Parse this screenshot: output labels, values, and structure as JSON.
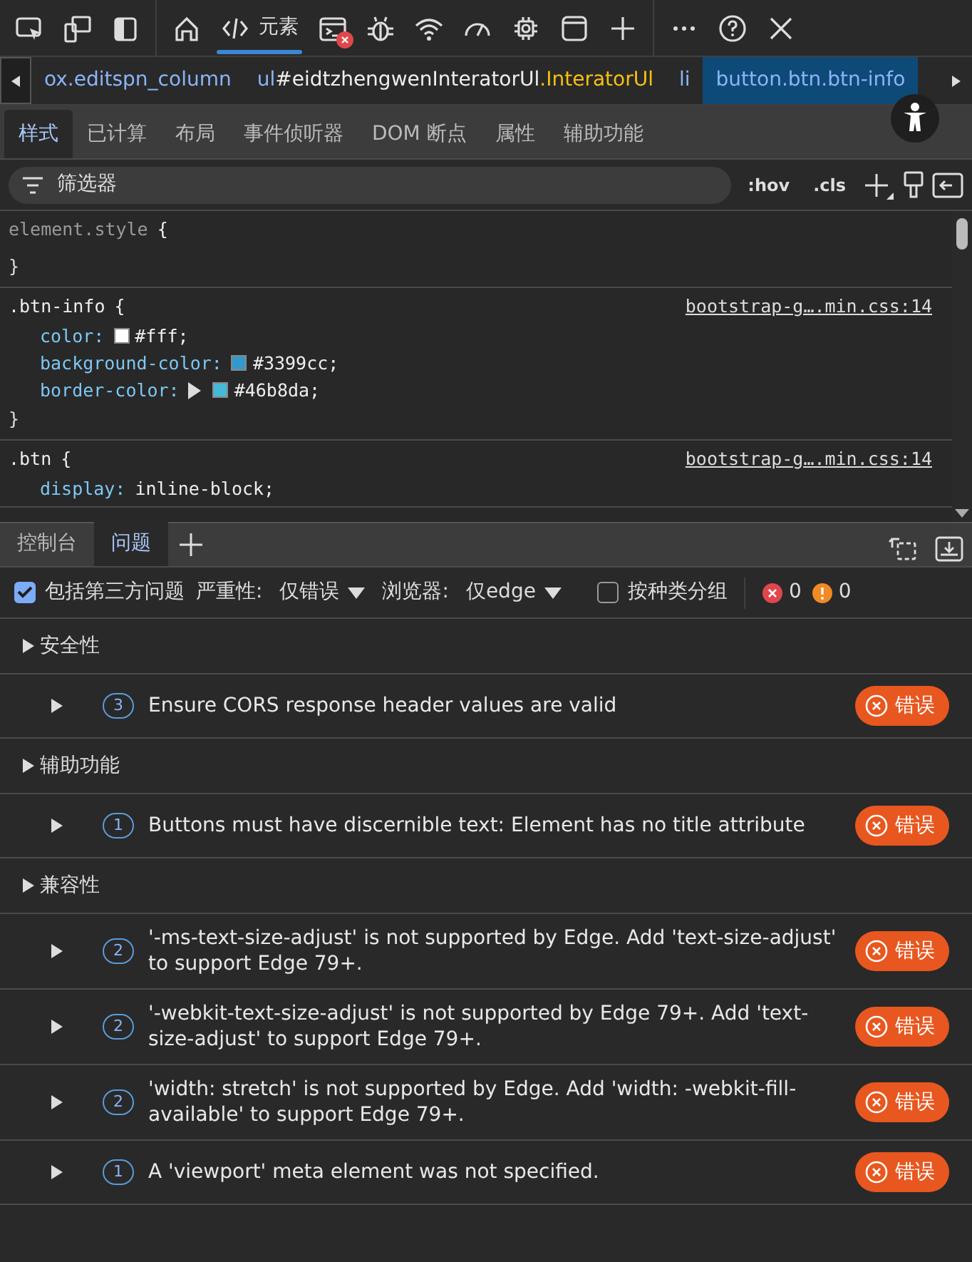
{
  "toolbar": {
    "tools": [
      {
        "kind": "inspect",
        "selected": false
      },
      {
        "kind": "device",
        "selected": false
      },
      {
        "kind": "dock",
        "selected": false
      },
      {
        "kind": "home",
        "selected": false
      },
      {
        "kind": "elements",
        "label": "元素",
        "selected": true
      },
      {
        "kind": "console",
        "selected": false,
        "error": true
      },
      {
        "kind": "bug",
        "selected": false
      },
      {
        "kind": "wifi",
        "selected": false
      },
      {
        "kind": "gauge",
        "selected": false
      },
      {
        "kind": "chip",
        "selected": false
      },
      {
        "kind": "window",
        "selected": false
      },
      {
        "kind": "plus",
        "selected": false
      }
    ],
    "actions": [
      {
        "kind": "more"
      },
      {
        "kind": "help"
      },
      {
        "kind": "close"
      }
    ]
  },
  "breadcrumbs": [
    {
      "parts": [
        {
          "text": "ox.editspn_column",
          "kind": "tag"
        }
      ],
      "selected": false
    },
    {
      "parts": [
        {
          "text": "ul",
          "kind": "tag"
        },
        {
          "text": "#eidtzhengwenInteratorUl",
          "kind": "id"
        },
        {
          "text": ".InteratorUl",
          "kind": "class"
        }
      ],
      "selected": false
    },
    {
      "parts": [
        {
          "text": "li",
          "kind": "tag"
        }
      ],
      "selected": false
    },
    {
      "parts": [
        {
          "text": "button.btn.btn-info",
          "kind": "tag"
        }
      ],
      "selected": true
    }
  ],
  "style_tabs": [
    {
      "label": "样式",
      "selected": true
    },
    {
      "label": "已计算",
      "selected": false
    },
    {
      "label": "布局",
      "selected": false
    },
    {
      "label": "事件侦听器",
      "selected": false
    },
    {
      "label": "DOM 断点",
      "selected": false
    },
    {
      "label": "属性",
      "selected": false
    },
    {
      "label": "辅助功能",
      "selected": false
    }
  ],
  "filter": {
    "placeholder": "筛选器",
    "buttons": [
      ":hov",
      ".cls"
    ]
  },
  "rules": [
    {
      "kind": "inline",
      "selector": "element.style",
      "open": "{",
      "close": "}"
    },
    {
      "kind": "rule",
      "selector": ".btn-info",
      "open": "{",
      "source": "bootstrap-g….min.css:14",
      "declarations": [
        {
          "property": "color:",
          "value": "#fff;",
          "color": "#ffffff",
          "expandable": false
        },
        {
          "property": "background-color:",
          "value": "#3399cc;",
          "color": "#3399cc",
          "expandable": false
        },
        {
          "property": "border-color:",
          "value": "#46b8da;",
          "color": "#46b8da",
          "expandable": true
        }
      ],
      "close": "}"
    },
    {
      "kind": "rule",
      "selector": ".btn",
      "open": "{",
      "source": "bootstrap-g….min.css:14",
      "declarations": [
        {
          "property": "display:",
          "value": "inline-block;",
          "expandable": false
        }
      ]
    }
  ],
  "drawer_tabs": [
    {
      "label": "控制台",
      "selected": false
    },
    {
      "label": "问题",
      "selected": true
    }
  ],
  "issues_toolbar": {
    "third_party": {
      "label": "包括第三方问题",
      "checked": true
    },
    "severity": {
      "label": "严重性:",
      "value": "仅错误"
    },
    "browser": {
      "label": "浏览器:",
      "value": "仅edge"
    },
    "group_by_kind": {
      "label": "按种类分组",
      "checked": false
    },
    "errors": "0",
    "warnings": "0"
  },
  "groups": [
    {
      "title": "安全性",
      "issues": [
        {
          "count": "3",
          "text": "Ensure CORS response header values are valid",
          "severity": "错误"
        }
      ]
    },
    {
      "title": "辅助功能",
      "issues": [
        {
          "count": "1",
          "text": "Buttons must have discernible text: Element has no title attribute",
          "severity": "错误"
        }
      ]
    },
    {
      "title": "兼容性",
      "issues": [
        {
          "count": "2",
          "text": "'-ms-text-size-adjust' is not supported by Edge. Add 'text-size-adjust' to support Edge 79+.",
          "severity": "错误"
        },
        {
          "count": "2",
          "text": "'-webkit-text-size-adjust' is not supported by Edge 79+. Add 'text-size-adjust' to support Edge 79+.",
          "severity": "错误"
        },
        {
          "count": "2",
          "text": "'width: stretch' is not supported by Edge. Add 'width: -webkit-fill-available' to support Edge 79+.",
          "severity": "错误"
        },
        {
          "count": "1",
          "text": "A 'viewport' meta element was not specified.",
          "severity": "错误"
        }
      ]
    }
  ]
}
